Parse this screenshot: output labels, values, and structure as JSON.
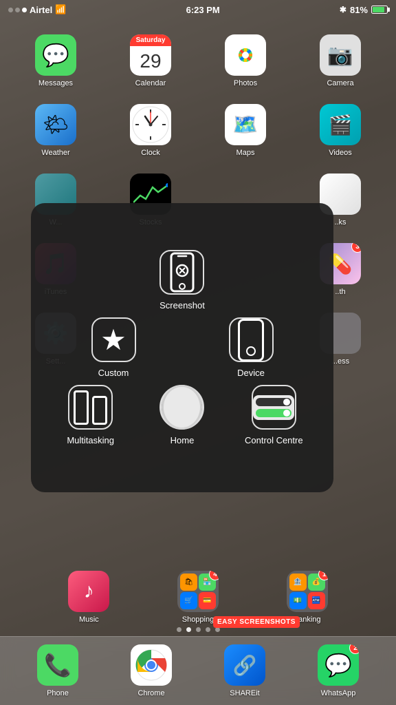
{
  "statusBar": {
    "carrier": "Airtel",
    "time": "6:23 PM",
    "battery": "81%",
    "batteryLevel": 81
  },
  "appGrid": {
    "rows": [
      [
        {
          "id": "messages",
          "label": "Messages",
          "icon": "messages"
        },
        {
          "id": "calendar",
          "label": "Calendar",
          "icon": "calendar",
          "calMonth": "Saturday",
          "calDay": "29"
        },
        {
          "id": "photos",
          "label": "Photos",
          "icon": "photos"
        },
        {
          "id": "camera",
          "label": "Camera",
          "icon": "camera"
        }
      ],
      [
        {
          "id": "weather",
          "label": "Weather",
          "icon": "weather"
        },
        {
          "id": "clock",
          "label": "Clock",
          "icon": "clock"
        },
        {
          "id": "maps",
          "label": "Maps",
          "icon": "maps"
        },
        {
          "id": "videos",
          "label": "Videos",
          "icon": "videos"
        }
      ],
      [
        {
          "id": "w",
          "label": "W...",
          "icon": "w"
        },
        {
          "id": "stocks",
          "label": "Stocks",
          "icon": "stocks"
        },
        {
          "id": "blank1",
          "label": "",
          "icon": "blank"
        },
        {
          "id": "ks",
          "label": "..ks",
          "icon": "ks"
        }
      ],
      [
        {
          "id": "itunes",
          "label": "iTunes",
          "icon": "itunes"
        },
        {
          "id": "blank2",
          "label": "",
          "icon": "blank"
        },
        {
          "id": "blank3",
          "label": "",
          "icon": "blank"
        },
        {
          "id": "th",
          "label": "..th",
          "icon": "th",
          "badge": 3
        }
      ],
      [
        {
          "id": "settings",
          "label": "Sett...",
          "icon": "settings"
        },
        {
          "id": "blank4",
          "label": "",
          "icon": "blank"
        },
        {
          "id": "blank5",
          "label": "",
          "icon": "blank"
        },
        {
          "id": "access",
          "label": "...ess",
          "icon": "access"
        }
      ]
    ]
  },
  "assistiveMenu": {
    "items": [
      {
        "id": "screenshot",
        "label": "Screenshot",
        "position": "top-center"
      },
      {
        "id": "custom",
        "label": "Custom",
        "position": "middle-left"
      },
      {
        "id": "device",
        "label": "Device",
        "position": "middle-right"
      },
      {
        "id": "multitasking",
        "label": "Multitasking",
        "position": "bottom-left"
      },
      {
        "id": "home",
        "label": "Home",
        "position": "bottom-center"
      },
      {
        "id": "control-centre",
        "label": "Control\nCentre",
        "position": "bottom-right"
      }
    ]
  },
  "bottomApps": [
    {
      "id": "music",
      "label": "Music",
      "icon": "music"
    },
    {
      "id": "shopping",
      "label": "Shopping",
      "icon": "shopping",
      "badge": 4
    },
    {
      "id": "banking",
      "label": "Banking",
      "icon": "banking",
      "badge": 1
    }
  ],
  "pageDots": [
    false,
    true,
    false,
    false,
    false
  ],
  "dock": [
    {
      "id": "phone",
      "label": "Phone",
      "icon": "phone"
    },
    {
      "id": "chrome",
      "label": "Chrome",
      "icon": "chrome"
    },
    {
      "id": "shareit",
      "label": "SHAREit",
      "icon": "shareit"
    },
    {
      "id": "whatsapp",
      "label": "WhatsApp",
      "icon": "whatsapp",
      "badge": 2
    }
  ],
  "easyScreenshots": "EASY SCREENSHOTS"
}
